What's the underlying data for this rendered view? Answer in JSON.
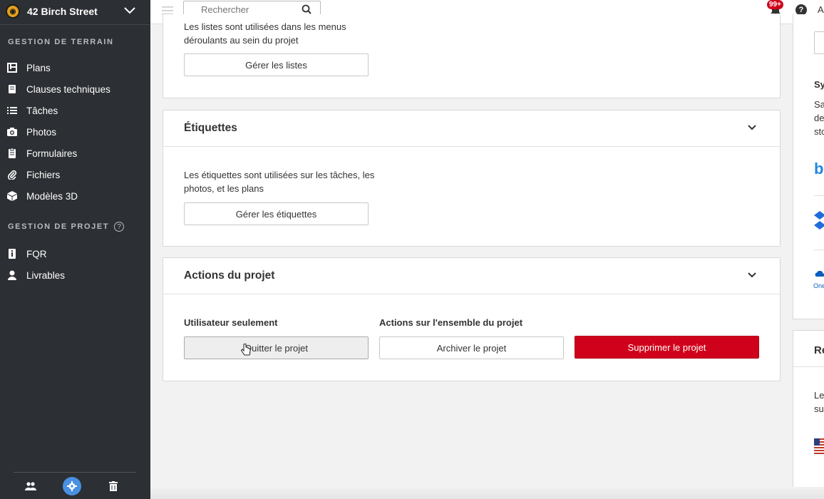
{
  "project": {
    "name": "42 Birch Street"
  },
  "sidebar": {
    "section_field": "GESTION DE TERRAIN",
    "field_items": [
      {
        "label": "Plans",
        "icon": "plans-icon"
      },
      {
        "label": "Clauses techniques",
        "icon": "specs-icon"
      },
      {
        "label": "Tâches",
        "icon": "tasks-icon"
      },
      {
        "label": "Photos",
        "icon": "camera-icon"
      },
      {
        "label": "Formulaires",
        "icon": "forms-icon"
      },
      {
        "label": "Fichiers",
        "icon": "paperclip-icon"
      },
      {
        "label": "Modèles 3D",
        "icon": "cube-icon"
      }
    ],
    "section_project": "GESTION DE PROJET",
    "project_items": [
      {
        "label": "FQR",
        "icon": "rfi-icon"
      },
      {
        "label": "Livrables",
        "icon": "person-icon"
      }
    ]
  },
  "topbar": {
    "search_placeholder": "Rechercher",
    "notification_count": "99+",
    "help_glyph": "?",
    "avatar_initial": "A"
  },
  "lists_panel": {
    "description": "Les listes sont utilisées dans les menus déroulants au sein du projet",
    "button_label": "Gérer les listes"
  },
  "tags_panel": {
    "title": "Étiquettes",
    "description": "Les étiquettes sont utilisées sur les tâches, les photos, et les plans",
    "button_label": "Gérer les étiquettes"
  },
  "actions_panel": {
    "title": "Actions du projet",
    "user_only_label": "Utilisateur seulement",
    "whole_project_label": "Actions sur l'ensemble du projet",
    "leave_button": "Quitter le projet",
    "archive_button": "Archiver le projet",
    "delete_button": "Supprimer le projet"
  },
  "right_column": {
    "sync_title": "Sy",
    "sync_lines": [
      "Sa",
      "de",
      "sto"
    ],
    "onedrive_label": "One",
    "second_title": "Ré",
    "second_lines": [
      "Les",
      "sur"
    ]
  },
  "colors": {
    "danger": "#d0021b",
    "sidebar": "#2c2f33",
    "accent": "#4a90e2"
  }
}
